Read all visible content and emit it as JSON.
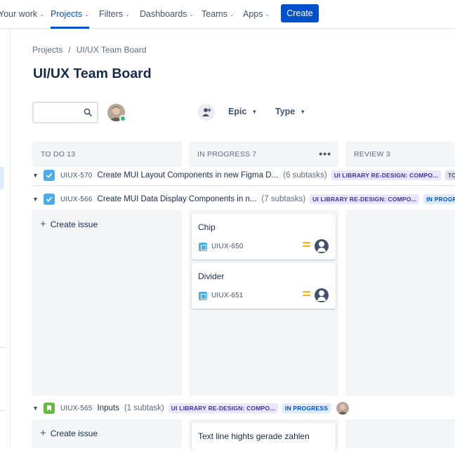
{
  "nav": {
    "items": [
      {
        "label": "Your work"
      },
      {
        "label": "Projects"
      },
      {
        "label": "Filters"
      },
      {
        "label": "Dashboards"
      },
      {
        "label": "Teams"
      },
      {
        "label": "Apps"
      }
    ],
    "active": "Projects",
    "create_label": "Create"
  },
  "breadcrumb": {
    "root": "Projects",
    "separator": "/",
    "current": "UI/UX Team Board"
  },
  "page_title": "UI/UX Team Board",
  "search": {
    "placeholder": "",
    "value": ""
  },
  "filters": {
    "epic_label": "Epic",
    "type_label": "Type"
  },
  "columns": [
    {
      "label": "TO DO 13"
    },
    {
      "label": "IN PROGRESS 7",
      "menu": "•••"
    },
    {
      "label": "REVIEW 3"
    }
  ],
  "swimlanes": [
    {
      "key": "UIUX-570",
      "summary": "Create MUI Layout Components in new Figma D...",
      "subtasks": "(6 subtasks)",
      "epic": "UI LIBRARY RE-DESIGN: COMPO...",
      "status": "TO"
    },
    {
      "key": "UIUX-566",
      "summary": "Create MUI Data Display Components in n...",
      "subtasks": "(7 subtasks)",
      "epic": "UI LIBRARY RE-DESIGN: COMPO...",
      "status": "IN PROGR"
    },
    {
      "key": "UIUX-565",
      "summary": "Inputs",
      "subtasks": "(1 subtask)",
      "epic": "UI LIBRARY RE-DESIGN: COMPO...",
      "status": "IN PROGRESS"
    }
  ],
  "create_issue_label": "Create issue",
  "cards": [
    {
      "title": "Chip",
      "key": "UIUX-650",
      "priority": "medium"
    },
    {
      "title": "Divider",
      "key": "UIUX-651",
      "priority": "medium"
    },
    {
      "title": "Text line hights gerade zahlen"
    }
  ],
  "colors": {
    "accent": "#0052cc",
    "epic_bg": "#eae6ff",
    "epic_text": "#403294",
    "column_bg": "#f4f5f7",
    "priority_medium": "#ffab00"
  }
}
